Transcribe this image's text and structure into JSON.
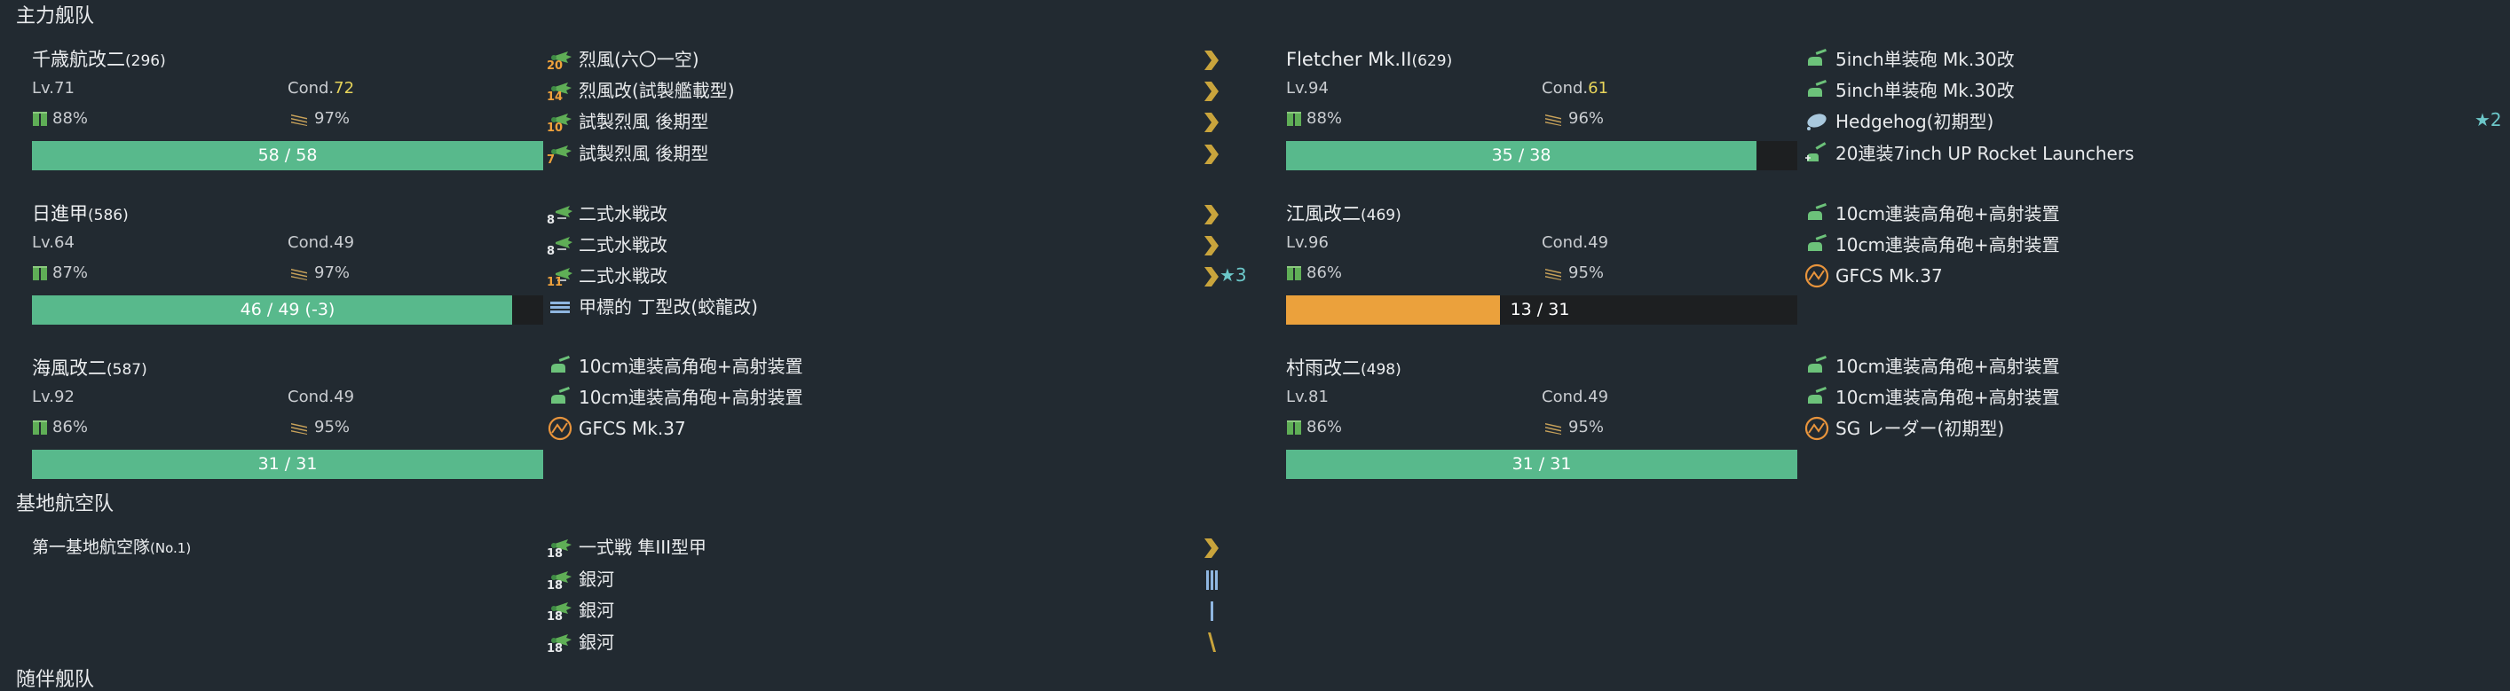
{
  "sections": {
    "main_fleet": "主力舰队",
    "land_base": "基地航空队",
    "escort_fleet": "随伴舰队"
  },
  "ships": [
    {
      "name": "千歳航改二",
      "id": "(296)",
      "level": "Lv.71",
      "cond_label": "Cond.",
      "cond": "72",
      "fuel": "88%",
      "ammo": "97%",
      "hp": "58 / 58",
      "hp_fraction": 1.0,
      "equipment": [
        {
          "slot": "20",
          "name": "烈風(六〇一空)",
          "icon": "fighter-plane-icon"
        },
        {
          "slot": "14",
          "name": "烈風改(試製艦載型)",
          "icon": "fighter-plane-icon"
        },
        {
          "slot": "10",
          "name": "試製烈風 後期型",
          "icon": "fighter-plane-icon"
        },
        {
          "slot": "7",
          "name": "試製烈風 後期型",
          "icon": "fighter-plane-icon"
        }
      ]
    },
    {
      "name": "Fletcher Mk.II",
      "id": "(629)",
      "level": "Lv.94",
      "cond_label": "Cond.",
      "cond": "61",
      "fuel": "88%",
      "ammo": "96%",
      "hp": "35 / 38",
      "hp_fraction": 0.921,
      "equipment": [
        {
          "slot": "",
          "name": "5inch単装砲 Mk.30改",
          "icon": "small-gun-icon"
        },
        {
          "slot": "",
          "name": "5inch単装砲 Mk.30改",
          "icon": "small-gun-icon"
        },
        {
          "slot": "",
          "name": "Hedgehog(初期型)",
          "icon": "depth-charge-icon",
          "star": "★2"
        },
        {
          "slot": "",
          "name": "20連装7inch UP Rocket Launchers",
          "icon": "rocket-launcher-icon"
        }
      ]
    },
    {
      "name": "日進甲",
      "id": "(586)",
      "level": "Lv.64",
      "cond_label": "Cond.",
      "cond": "49",
      "fuel": "87%",
      "ammo": "97%",
      "hp": "46 / 49 (-3)",
      "hp_fraction": 0.939,
      "equipment": [
        {
          "slot": "8",
          "name": "二式水戦改",
          "icon": "seaplane-fighter-icon"
        },
        {
          "slot": "8",
          "name": "二式水戦改",
          "icon": "seaplane-fighter-icon"
        },
        {
          "slot": "11",
          "name": "二式水戦改",
          "icon": "seaplane-fighter-icon",
          "star": "★3"
        },
        {
          "slot": "",
          "name": "甲標的 丁型改(蛟龍改)",
          "icon": "midget-submarine-icon"
        }
      ]
    },
    {
      "name": "江風改二",
      "id": "(469)",
      "level": "Lv.96",
      "cond_label": "Cond.",
      "cond": "49",
      "fuel": "86%",
      "ammo": "95%",
      "hp": "13 / 31",
      "hp_fraction": 0.419,
      "equipment": [
        {
          "slot": "",
          "name": "10cm連装高角砲+高射装置",
          "icon": "small-gun-icon"
        },
        {
          "slot": "",
          "name": "10cm連装高角砲+高射装置",
          "icon": "small-gun-icon"
        },
        {
          "slot": "",
          "name": "GFCS Mk.37",
          "icon": "fire-control-icon"
        }
      ]
    },
    {
      "name": "海風改二",
      "id": "(587)",
      "level": "Lv.92",
      "cond_label": "Cond.",
      "cond": "49",
      "fuel": "86%",
      "ammo": "95%",
      "hp": "31 / 31",
      "hp_fraction": 1.0,
      "equipment": [
        {
          "slot": "",
          "name": "10cm連装高角砲+高射装置",
          "icon": "small-gun-icon"
        },
        {
          "slot": "",
          "name": "10cm連装高角砲+高射装置",
          "icon": "small-gun-icon"
        },
        {
          "slot": "",
          "name": "GFCS Mk.37",
          "icon": "fire-control-icon"
        }
      ]
    },
    {
      "name": "村雨改二",
      "id": "(498)",
      "level": "Lv.81",
      "cond_label": "Cond.",
      "cond": "49",
      "fuel": "86%",
      "ammo": "95%",
      "hp": "31 / 31",
      "hp_fraction": 1.0,
      "equipment": [
        {
          "slot": "",
          "name": "10cm連装高角砲+高射装置",
          "icon": "small-gun-icon"
        },
        {
          "slot": "",
          "name": "10cm連装高角砲+高射装置",
          "icon": "small-gun-icon"
        },
        {
          "slot": "",
          "name": "SG レーダー(初期型)",
          "icon": "fire-control-icon"
        }
      ]
    }
  ],
  "land_base": {
    "name": "第一基地航空隊",
    "id": "(No.1)",
    "equipment": [
      {
        "slot": "18",
        "name": "一式戦 隼III型甲",
        "icon": "land-fighter-icon"
      },
      {
        "slot": "18",
        "name": "銀河",
        "icon": "land-attacker-icon"
      },
      {
        "slot": "18",
        "name": "銀河",
        "icon": "land-attacker-icon"
      },
      {
        "slot": "18",
        "name": "銀河",
        "icon": "land-attacker-icon"
      }
    ]
  },
  "colors": {
    "background": "#222a31",
    "hp_green": "#58b98c",
    "hp_orange": "#eba13c",
    "proficiency_gold": "#c9a43c",
    "proficiency_blue": "#8fb6e0",
    "star_cyan": "#6cc7c9",
    "cond_sparkle": "#e7d45a"
  }
}
